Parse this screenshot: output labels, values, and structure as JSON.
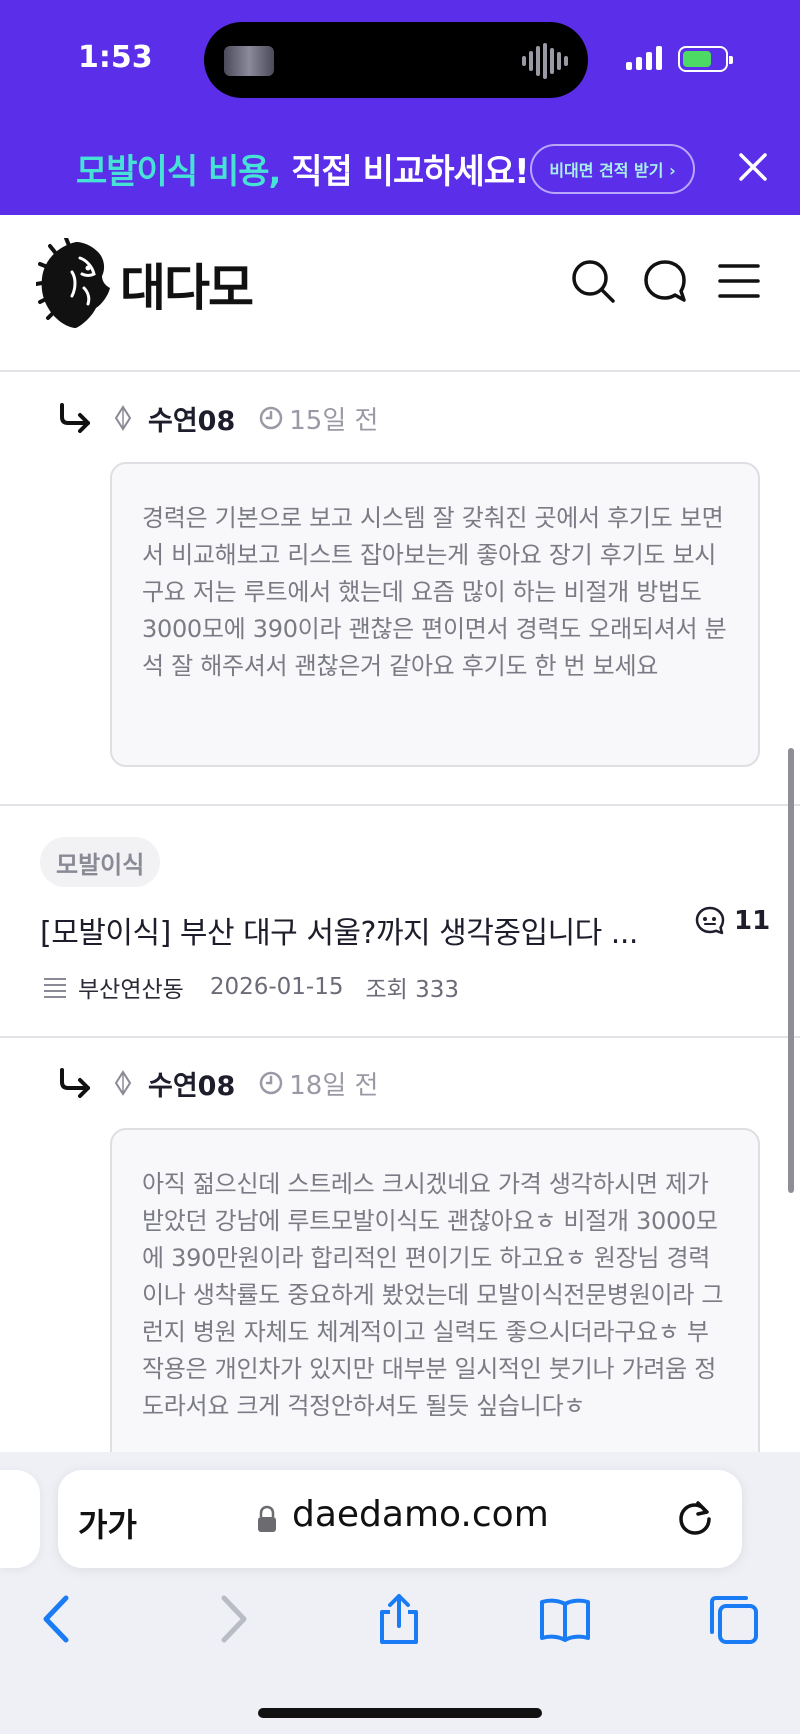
{
  "status_bar": {
    "time": "1:53"
  },
  "banner": {
    "headline_highlight": "모발이식 비용,",
    "headline_rest": " 직접 비교하세요!",
    "cta_label": "비대면 견적 받기 ›"
  },
  "header": {
    "logo_text": "대다모"
  },
  "comments": [
    {
      "author": "수연08",
      "time_ago": "15일 전",
      "text": "경력은 기본으로 보고 시스템 잘 갖춰진 곳에서 후기도 보면서 비교해보고 리스트 잡아보는게 좋아요 장기 후기도 보시구요 저는 루트에서 했는데 요즘 많이 하는 비절개 방법도 3000모에 390이라 괜찮은 편이면서 경력도 오래되셔서 분석 잘 해주셔서 괜찮은거 같아요 후기도 한 번 보세요"
    },
    {
      "author": "수연08",
      "time_ago": "18일 전",
      "text": "아직 젊으신데 스트레스 크시겠네요 가격 생각하시면 제가 받았던 강남에 루트모발이식도 괜찮아요ㅎ 비절개 3000모에 390만원이라 합리적인 편이기도 하고요ㅎ 원장님 경력이나 생착률도 중요하게 봤었는데 모발이식전문병원이라 그런지 병원 자체도 체계적이고 실력도 좋으시더라구요ㅎ 부작용은 개인차가 있지만 대부분 일시적인 붓기나 가려움 정도라서요 크게 걱정안하셔도 될듯 싶습니다ㅎ"
    }
  ],
  "post": {
    "tag": "모발이식",
    "title": "[모발이식] 부산 대구 서울?까지 생각중입니다 ...",
    "comment_count": "11",
    "board": "부산연산동",
    "date": "2026-01-15",
    "views": "조회 333"
  },
  "browser": {
    "text_size_label": "가가",
    "url": "daedamo.com"
  },
  "colors": {
    "banner_bg": "#5b2eea",
    "banner_highlight": "#46e3d5",
    "ios_blue": "#1a7cf5"
  }
}
